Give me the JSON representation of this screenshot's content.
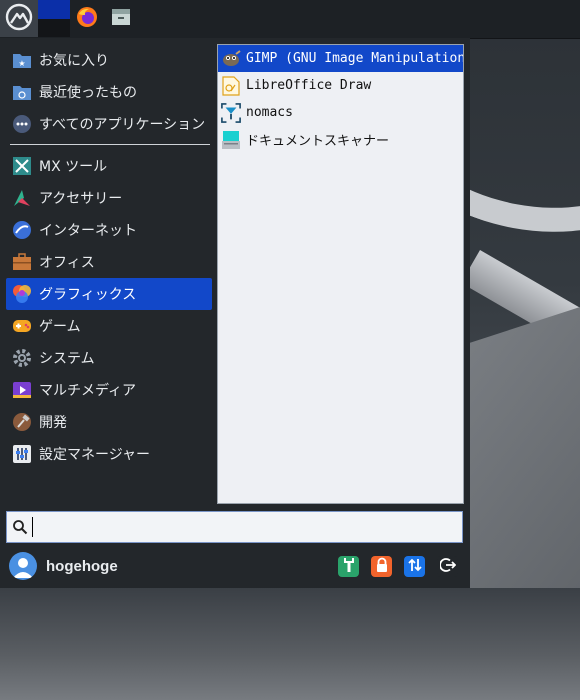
{
  "panel": {
    "launcher_icon": "mx-logo-icon",
    "workspace_icon": "workspace-switcher-icon",
    "browser_icon": "firefox-icon",
    "files_icon": "file-manager-icon"
  },
  "categories": [
    {
      "label": "お気に入り",
      "icon": "favorites-folder-icon"
    },
    {
      "label": "最近使ったもの",
      "icon": "recent-folder-icon"
    },
    {
      "label": "すべてのアプリケーション",
      "icon": "all-apps-icon"
    },
    {
      "label": "MX ツール",
      "icon": "mx-tools-icon"
    },
    {
      "label": "アクセサリー",
      "icon": "accessories-icon"
    },
    {
      "label": "インターネット",
      "icon": "internet-icon"
    },
    {
      "label": "オフィス",
      "icon": "office-icon"
    },
    {
      "label": "グラフィックス",
      "icon": "graphics-icon",
      "active": true
    },
    {
      "label": "ゲーム",
      "icon": "games-icon"
    },
    {
      "label": "システム",
      "icon": "system-icon"
    },
    {
      "label": "マルチメディア",
      "icon": "multimedia-icon"
    },
    {
      "label": "開発",
      "icon": "development-icon"
    },
    {
      "label": "設定マネージャー",
      "icon": "settings-manager-icon"
    }
  ],
  "apps": [
    {
      "label": "GIMP (GNU Image Manipulation…",
      "icon": "gimp-icon",
      "active": true
    },
    {
      "label": "LibreOffice Draw",
      "icon": "libreoffice-draw-icon"
    },
    {
      "label": "nomacs",
      "icon": "nomacs-icon"
    },
    {
      "label": "ドキュメントスキャナー",
      "icon": "scanner-icon"
    }
  ],
  "search": {
    "value": "",
    "placeholder": ""
  },
  "user": {
    "name": "hogehoge"
  },
  "actions": [
    {
      "icon": "settings-wrench-icon",
      "color": "#2aa36b"
    },
    {
      "icon": "lock-icon",
      "color": "#f2642c"
    },
    {
      "icon": "switch-user-icon",
      "color": "#1a73e8"
    },
    {
      "icon": "logout-icon",
      "color": "#23272b"
    }
  ],
  "colors": {
    "accent": "#1248c9",
    "menu_bg": "#23272b",
    "list_bg": "#eef0f4"
  }
}
